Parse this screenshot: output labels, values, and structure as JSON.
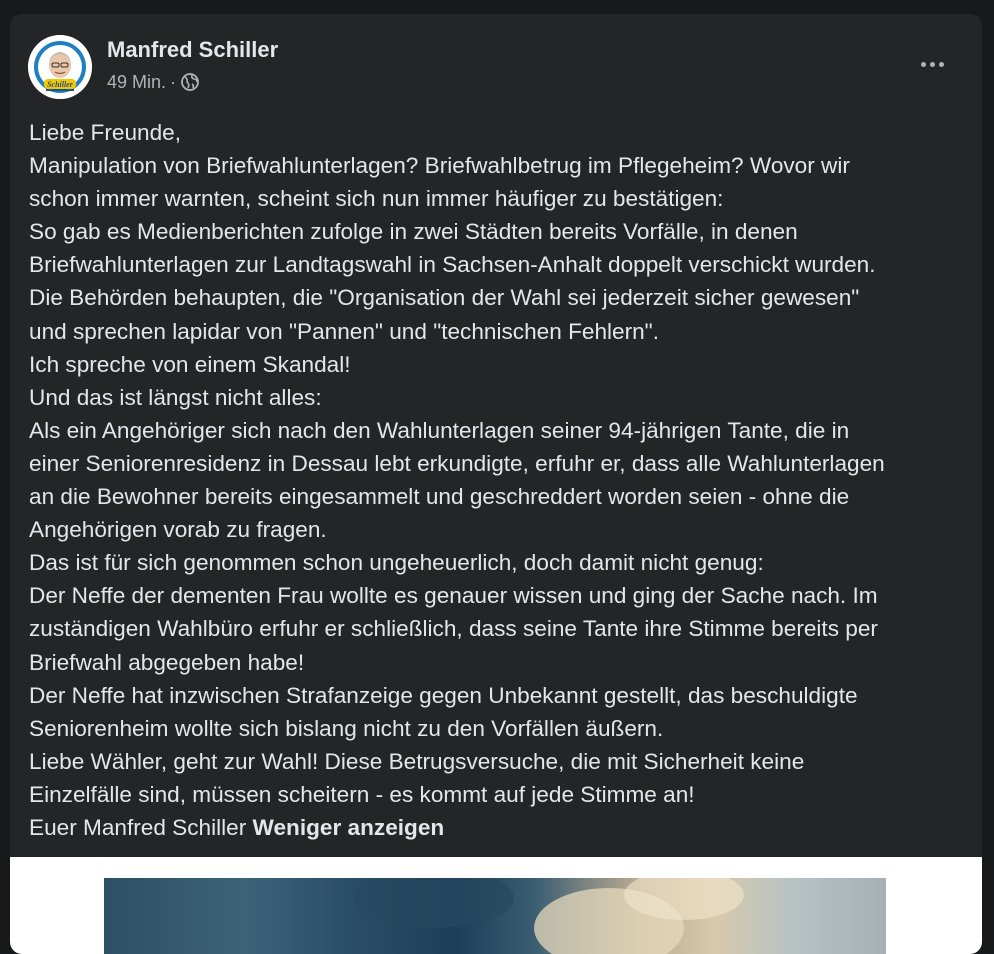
{
  "post": {
    "author": "Manfred Schiller",
    "timestamp": "49 Min.",
    "separator": "·",
    "privacy_icon": "globe-icon",
    "avatar_caption": "Schiller",
    "more_icon": "more-horizontal-icon",
    "lines": [
      "Liebe Freunde,",
      "Manipulation von Briefwahlunterlagen? Briefwahlbetrug im Pflegeheim? Wovor wir",
      "schon immer warnten, scheint sich nun immer häufiger zu bestätigen:",
      "So gab es Medienberichten zufolge in zwei Städten bereits Vorfälle, in denen",
      "Briefwahlunterlagen zur Landtagswahl in Sachsen-Anhalt doppelt verschickt wurden.",
      "Die Behörden behaupten, die \"Organisation der Wahl sei jederzeit sicher gewesen\"",
      "und sprechen lapidar von \"Pannen\" und \"technischen Fehlern\".",
      "Ich spreche von einem Skandal!",
      "Und das ist längst nicht alles:",
      "Als ein Angehöriger sich nach den Wahlunterlagen seiner 94-jährigen Tante, die in",
      "einer Seniorenresidenz in Dessau lebt erkundigte, erfuhr er,  dass alle Wahlunterlagen",
      "an die Bewohner bereits eingesammelt und geschreddert worden seien - ohne die",
      "Angehörigen vorab zu fragen.",
      "Das ist für sich genommen schon ungeheuerlich, doch damit nicht genug:",
      "Der Neffe der dementen Frau wollte es genauer wissen und ging der Sache nach. Im",
      "zuständigen Wahlbüro erfuhr er schließlich, dass seine Tante ihre Stimme bereits per",
      "Briefwahl abgegeben habe!",
      "Der Neffe hat inzwischen Strafanzeige gegen Unbekannt gestellt, das beschuldigte",
      "Seniorenheim wollte sich bislang nicht zu den Vorfällen äußern.",
      "Liebe Wähler, geht zur Wahl! Diese Betrugsversuche, die mit Sicherheit keine",
      "Einzelfälle sind, müssen scheitern - es kommt auf jede Stimme an!"
    ],
    "signature": "Euer Manfred Schiller ",
    "see_less_label": "Weniger anzeigen"
  },
  "colors": {
    "page_bg": "#18191a",
    "card_bg": "#242526",
    "primary_text": "#e4e6eb",
    "secondary_text": "#b0b3b8"
  }
}
